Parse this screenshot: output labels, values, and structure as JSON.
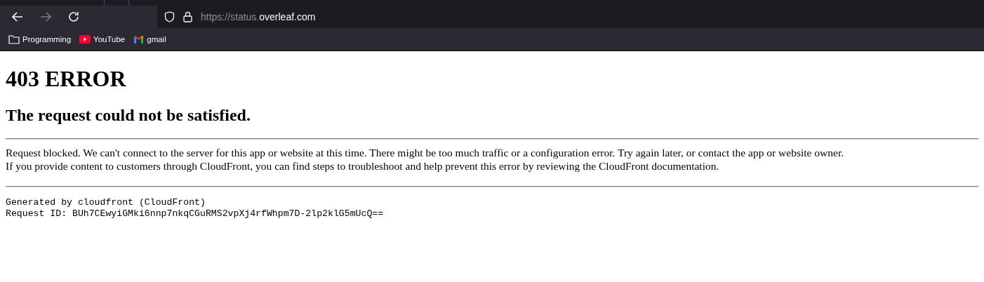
{
  "toolbar": {
    "nav": [
      {
        "kind": "back",
        "disabled": false
      },
      {
        "kind": "forward",
        "disabled": true
      },
      {
        "kind": "reload",
        "disabled": false
      }
    ],
    "address": {
      "prefix": "https://status.",
      "host": "overleaf.com"
    }
  },
  "bookmarks": [
    {
      "kind": "folder",
      "label": "Programming"
    },
    {
      "kind": "youtube",
      "label": "YouTube"
    },
    {
      "kind": "gmail",
      "label": "gmail"
    }
  ],
  "page": {
    "heading": "403 ERROR",
    "subheading": "The request could not be satisfied.",
    "message_lines": [
      "Request blocked. We can't connect to the server for this app or website at this time. There might be too much traffic or a configuration error. Try again later, or contact the app or website owner.",
      "If you provide content to customers through CloudFront, you can find steps to troubleshoot and help prevent this error by reviewing the CloudFront documentation."
    ],
    "footer_lines": [
      "Generated by cloudfront (CloudFront)",
      "Request ID: BUh7CEwyiGMki6nnp7nkqCGuRMS2vpXj4rfWhpm7D-2lp2klG5mUcQ=="
    ]
  }
}
